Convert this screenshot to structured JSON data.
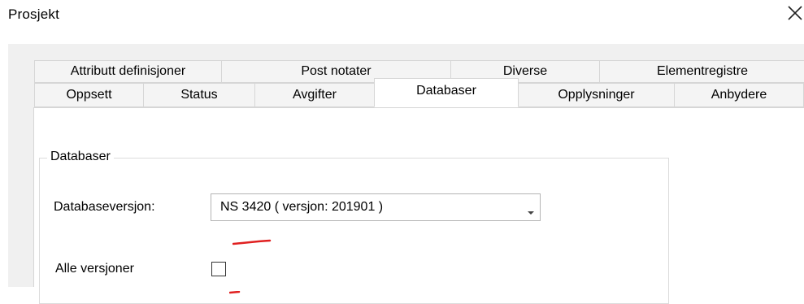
{
  "window": {
    "title": "Prosjekt"
  },
  "icons": {
    "close": "close-icon",
    "dropdown": "chevron-down-icon"
  },
  "colors": {
    "active_tab_bg": "#ffffff",
    "tab_bg": "#f4f4f4",
    "panel_bg": "#f0f0f0",
    "annotation_red": "#e02020"
  },
  "tabs": {
    "row1": [
      {
        "label": "Attributt definisjoner"
      },
      {
        "label": "Post notater"
      },
      {
        "label": "Diverse"
      },
      {
        "label": "Elementregistre"
      }
    ],
    "row2": [
      {
        "label": "Oppsett"
      },
      {
        "label": "Status"
      },
      {
        "label": "Avgifter"
      },
      {
        "label": "Databaser",
        "active": true
      },
      {
        "label": "Opplysninger"
      },
      {
        "label": "Anbydere"
      }
    ]
  },
  "databaser": {
    "group_title": "Databaser",
    "version_label": "Databaseversjon:",
    "version_value": "NS 3420 ( versjon: 201901 )",
    "all_versions_label": "Alle versjoner",
    "all_versions_checked": false
  }
}
